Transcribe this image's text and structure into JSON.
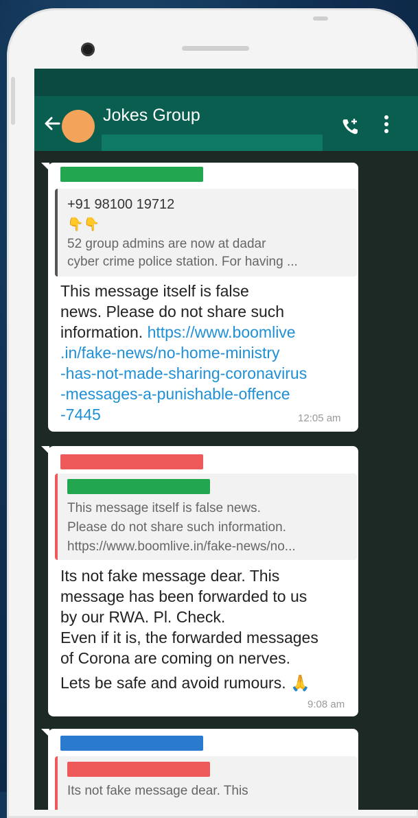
{
  "header": {
    "title": "Jokes Group",
    "redaction_color": "#0e7a63"
  },
  "colors": {
    "appbar": "#0a5e4f",
    "statusbar": "#0a4a40",
    "avatar": "#f4a35a",
    "link": "#1f8fd6",
    "redact_green": "#22a64f",
    "redact_red": "#ee5a5a",
    "redact_blue": "#2a7ad0"
  },
  "messages": [
    {
      "sender_redaction": "green",
      "quote": {
        "sender": "+91 98100 19712",
        "emoji": "👇👇",
        "line1": "52 group admins are now at dadar",
        "line2": "cyber crime police station. For having ..."
      },
      "lines": [
        "This message itself is false",
        "news. Please do not share such",
        "information."
      ],
      "link_lines": [
        "https://www.boomlive",
        ".in/fake-news/no-home-ministry",
        "-has-not-made-sharing-coronavirus",
        "-messages-a-punishable-offence",
        "-7445"
      ],
      "time": "12:05 am"
    },
    {
      "sender_redaction": "red",
      "quote": {
        "sender_redaction": "green",
        "line1": "This message itself is false news.",
        "line2": "Please do not share such information.",
        "line3": "https://www.boomlive.in/fake-news/no..."
      },
      "lines": [
        "Its not fake message dear. This",
        "message has been forwarded to us",
        "by our RWA. Pl. Check.",
        "Even if it is,  the forwarded messages",
        "of Corona are coming on nerves.",
        "Lets be safe and avoid rumours."
      ],
      "emoji": "🙏",
      "time": "9:08 am"
    },
    {
      "sender_redaction": "blue",
      "quote": {
        "sender_redaction": "red",
        "line1": "Its not fake message dear. This"
      }
    }
  ]
}
